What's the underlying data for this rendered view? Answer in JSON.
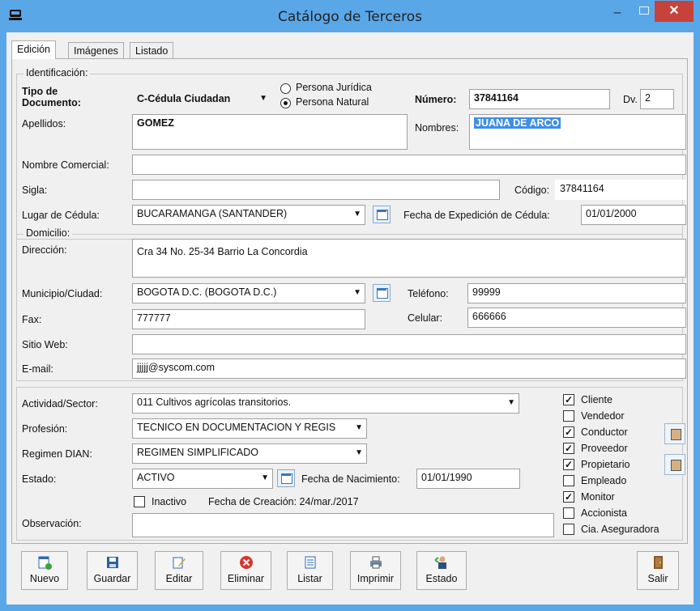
{
  "window": {
    "title": "Catálogo de Terceros",
    "min": "–",
    "close": "✕"
  },
  "tabs": [
    "Edición",
    "Imágenes",
    "Listado"
  ],
  "identificacion": {
    "group_label": "Identificación:",
    "tipo_label": "Tipo de Documento:",
    "tipo_value": "C-Cédula Ciudadan",
    "persona_juridica": "Persona Jurídica",
    "persona_natural": "Persona Natural",
    "persona_selected": "natural",
    "numero_label": "Número:",
    "numero_value": "37841164",
    "dv_label": "Dv.",
    "dv_value": "2",
    "apellidos_label": "Apellidos:",
    "apellidos_value": "GOMEZ",
    "nombres_label": "Nombres:",
    "nombres_value": "JUANA DE ARCO",
    "nombre_comercial_label": "Nombre Comercial:",
    "nombre_comercial_value": "",
    "sigla_label": "Sigla:",
    "sigla_value": "",
    "codigo_label": "Código:",
    "codigo_value": "37841164",
    "lugar_cedula_label": "Lugar de Cédula:",
    "lugar_cedula_value": "BUCARAMANGA (SANTANDER)",
    "fecha_exp_label": "Fecha de Expedición de Cédula:",
    "fecha_exp_value": "01/01/2000"
  },
  "domicilio": {
    "group_label": "Domicilio:",
    "direccion_label": "Dirección:",
    "direccion_value": "Cra 34 No.  25-34  Barrio La  Concordia",
    "municipio_label": "Municipio/Ciudad:",
    "municipio_value": "BOGOTA D.C. (BOGOTA D.C.)",
    "telefono_label": "Teléfono:",
    "telefono_value": "99999",
    "fax_label": "Fax:",
    "fax_value": "777777",
    "celular_label": "Celular:",
    "celular_value": "666666",
    "sitio_label": "Sitio Web:",
    "sitio_value": "",
    "email_label": "E-mail:",
    "email_value": "jjjjj@syscom.com"
  },
  "otros": {
    "actividad_label": "Actividad/Sector:",
    "actividad_value": "011 Cultivos agrícolas transitorios.",
    "profesion_label": "Profesión:",
    "profesion_value": "TECNICO EN DOCUMENTACION Y REGIS",
    "regimen_label": "Regimen DIAN:",
    "regimen_value": "REGIMEN SIMPLIFICADO",
    "estado_label": "Estado:",
    "estado_value": "ACTIVO",
    "fecha_nac_label": "Fecha de Nacimiento:",
    "fecha_nac_value": "01/01/1990",
    "inactivo_label": "Inactivo",
    "fecha_creacion": "Fecha de Creación: 24/mar./2017",
    "observacion_label": "Observación:",
    "observacion_value": ""
  },
  "roles": [
    {
      "label": "Cliente",
      "checked": true
    },
    {
      "label": "Vendedor",
      "checked": false
    },
    {
      "label": "Conductor",
      "checked": true
    },
    {
      "label": "Proveedor",
      "checked": true
    },
    {
      "label": "Propietario",
      "checked": true
    },
    {
      "label": "Empleado",
      "checked": false
    },
    {
      "label": "Monitor",
      "checked": true
    },
    {
      "label": "Accionista",
      "checked": false
    },
    {
      "label": "Cia. Aseguradora",
      "checked": false
    }
  ],
  "toolbar": {
    "nuevo": "Nuevo",
    "guardar": "Guardar",
    "editar": "Editar",
    "eliminar": "Eliminar",
    "listar": "Listar",
    "imprimir": "Imprimir",
    "estado": "Estado",
    "salir": "Salir"
  },
  "check_mark": "✓",
  "arrow": "▼"
}
